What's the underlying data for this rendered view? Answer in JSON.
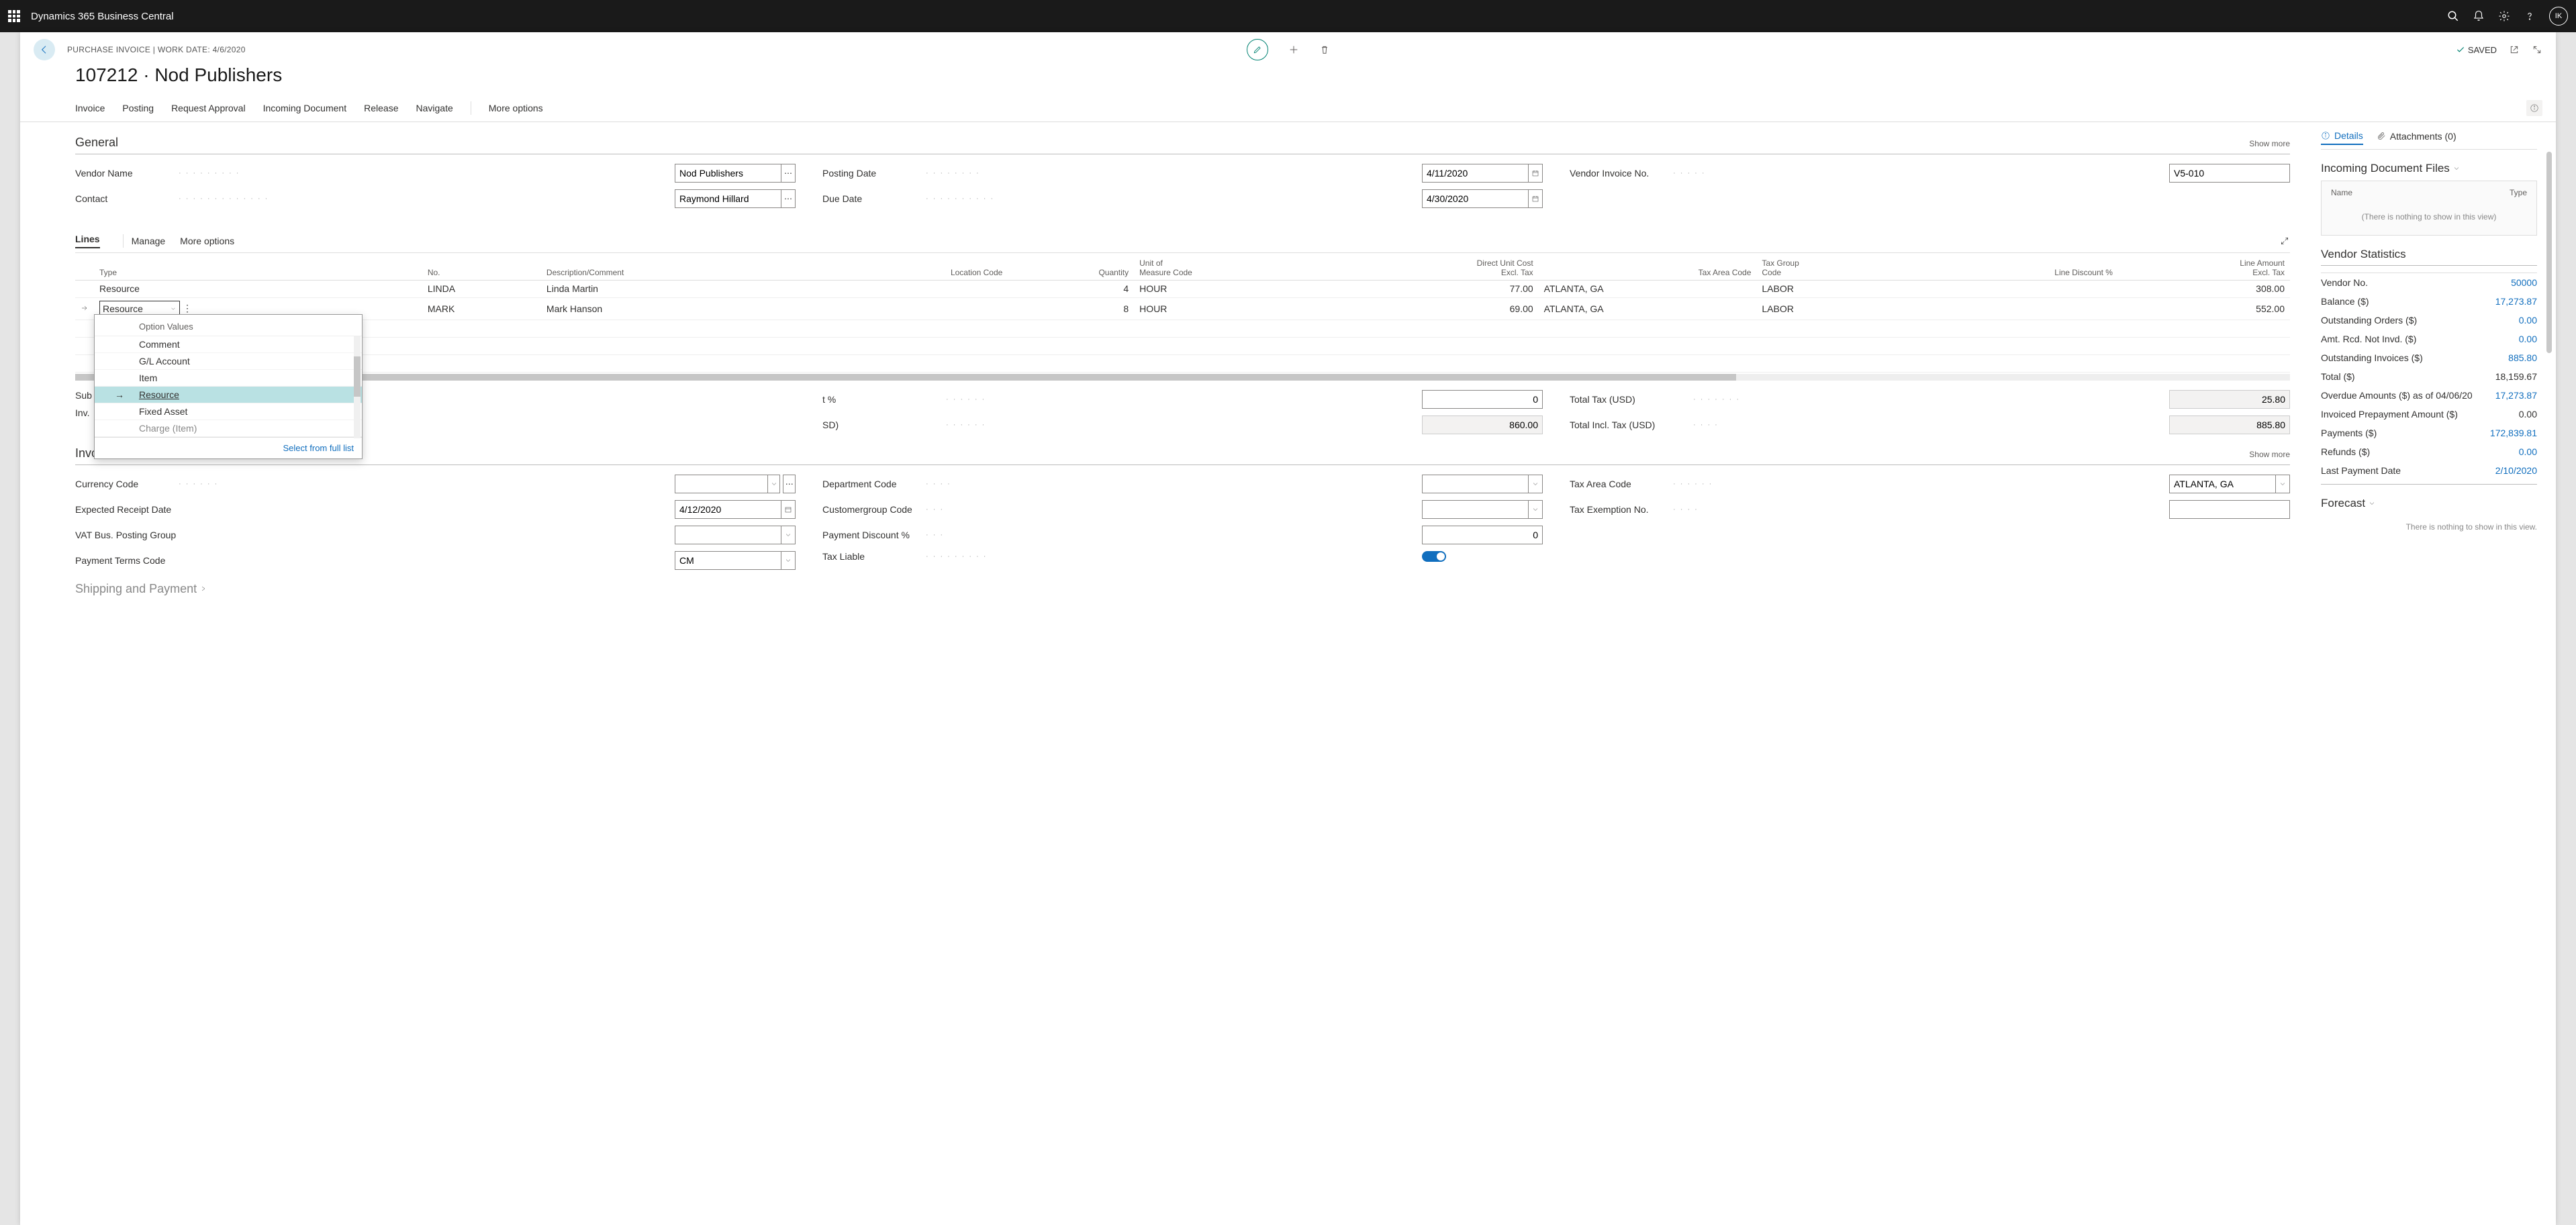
{
  "app_title": "Dynamics 365 Business Central",
  "avatar": "IK",
  "crumb": "PURCHASE INVOICE | WORK DATE: 4/6/2020",
  "page_title": "107212 · Nod Publishers",
  "saved_label": "SAVED",
  "actions": {
    "invoice": "Invoice",
    "posting": "Posting",
    "request_approval": "Request Approval",
    "incoming_doc": "Incoming Document",
    "release": "Release",
    "navigate": "Navigate",
    "more": "More options"
  },
  "general": {
    "title": "General",
    "show_more": "Show more",
    "vendor_name_label": "Vendor Name",
    "vendor_name": "Nod Publishers",
    "contact_label": "Contact",
    "contact": "Raymond Hillard",
    "posting_date_label": "Posting Date",
    "posting_date": "4/11/2020",
    "due_date_label": "Due Date",
    "due_date": "4/30/2020",
    "vendor_inv_label": "Vendor Invoice No.",
    "vendor_inv": "V5-010"
  },
  "lines": {
    "tab_lines": "Lines",
    "tab_manage": "Manage",
    "tab_more": "More options",
    "cols": {
      "type": "Type",
      "no": "No.",
      "desc": "Description/Comment",
      "loc": "Location Code",
      "qty": "Quantity",
      "uom": "Unit of\nMeasure Code",
      "cost": "Direct Unit Cost\nExcl. Tax",
      "taxarea": "Tax Area Code",
      "taxgrp": "Tax Group\nCode",
      "disc": "Line Discount %",
      "amt": "Line Amount\nExcl. Tax"
    },
    "rows": [
      {
        "type": "Resource",
        "no": "LINDA",
        "desc": "Linda Martin",
        "loc": "",
        "qty": "4",
        "uom": "HOUR",
        "cost": "77.00",
        "taxarea": "ATLANTA, GA",
        "taxgrp": "LABOR",
        "disc": "",
        "amt": "308.00"
      },
      {
        "type": "Resource",
        "no": "MARK",
        "desc": "Mark Hanson",
        "loc": "",
        "qty": "8",
        "uom": "HOUR",
        "cost": "69.00",
        "taxarea": "ATLANTA, GA",
        "taxgrp": "LABOR",
        "disc": "",
        "amt": "552.00"
      }
    ],
    "dropdown": {
      "header": "Option Values",
      "options": [
        "Comment",
        "G/L Account",
        "Item",
        "Resource",
        "Fixed Asset",
        "Charge (Item)"
      ],
      "selected": "Resource",
      "footer": "Select from full list"
    }
  },
  "totals": {
    "sub_label": "Sub",
    "inv_label": "Inv.",
    "pct_label": "t %",
    "pct": "0",
    "sd_label": "SD)",
    "sd": "860.00",
    "tax_label": "Total Tax (USD)",
    "tax": "25.80",
    "incl_label": "Total Incl. Tax (USD)",
    "incl": "885.80"
  },
  "inv_details": {
    "title": "Invoice Details",
    "show_more": "Show more",
    "currency_label": "Currency Code",
    "currency": "",
    "expected_label": "Expected Receipt Date",
    "expected": "4/12/2020",
    "vat_label": "VAT Bus. Posting Group",
    "vat": "",
    "terms_label": "Payment Terms Code",
    "terms": "CM",
    "dept_label": "Department Code",
    "dept": "",
    "cust_label": "Customergroup Code",
    "cust": "",
    "pdisc_label": "Payment Discount %",
    "pdisc": "0",
    "liable_label": "Tax Liable",
    "taxarea_label": "Tax Area Code",
    "taxarea": "ATLANTA, GA",
    "exempt_label": "Tax Exemption No.",
    "exempt": ""
  },
  "ship_title": "Shipping and Payment",
  "side": {
    "details_tab": "Details",
    "attach_tab": "Attachments (0)",
    "incoming_title": "Incoming Document Files",
    "col_name": "Name",
    "col_type": "Type",
    "empty_msg": "(There is nothing to show in this view)",
    "vstats_title": "Vendor Statistics",
    "stats": [
      {
        "k": "Vendor No.",
        "v": "50000",
        "link": true
      },
      {
        "k": "Balance ($)",
        "v": "17,273.87",
        "link": true
      },
      {
        "k": "Outstanding Orders ($)",
        "v": "0.00",
        "link": true
      },
      {
        "k": "Amt. Rcd. Not Invd. ($)",
        "v": "0.00",
        "link": true
      },
      {
        "k": "Outstanding Invoices ($)",
        "v": "885.80",
        "link": true
      },
      {
        "k": "Total ($)",
        "v": "18,159.67",
        "link": false
      },
      {
        "k": "Overdue Amounts ($) as of 04/06/20",
        "v": "17,273.87",
        "link": true
      },
      {
        "k": "Invoiced Prepayment Amount ($)",
        "v": "0.00",
        "link": false
      },
      {
        "k": "Payments ($)",
        "v": "172,839.81",
        "link": true
      },
      {
        "k": "Refunds ($)",
        "v": "0.00",
        "link": true
      },
      {
        "k": "Last Payment Date",
        "v": "2/10/2020",
        "link": true
      }
    ],
    "forecast_title": "Forecast",
    "forecast_empty": "There is nothing to show in this view."
  }
}
